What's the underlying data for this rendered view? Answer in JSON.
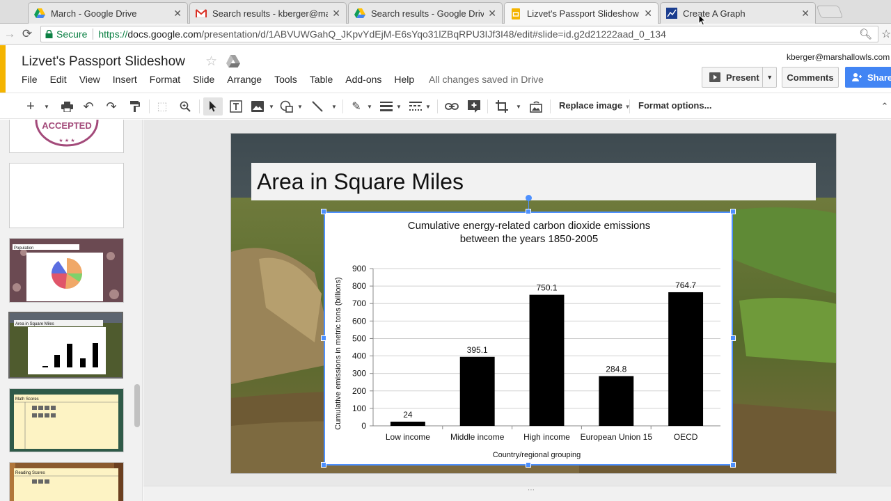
{
  "browser": {
    "tabs": [
      {
        "title": "March - Google Drive",
        "icon": "google-drive-icon"
      },
      {
        "title": "Search results - kberger@mars",
        "icon": "gmail-icon"
      },
      {
        "title": "Search results - Google Drive",
        "icon": "google-drive-icon"
      },
      {
        "title": "Lizvet's Passport Slideshow - G",
        "icon": "google-slides-icon",
        "active": true
      },
      {
        "title": "Create A Graph",
        "icon": "graph-icon"
      }
    ],
    "secure_label": "Secure",
    "url_scheme": "https://",
    "url_host": "docs.google.com",
    "url_path": "/presentation/d/1ABVUWGahQ_JKpvYdEjM-E6sYqo31lZBqRPU3IJf3I48/edit#slide=id.g2d21222aad_0_134"
  },
  "doc": {
    "title": "Lizvet's Passport Slideshow",
    "user_email": "kberger@marshallowls.com",
    "menu": [
      "File",
      "Edit",
      "View",
      "Insert",
      "Format",
      "Slide",
      "Arrange",
      "Tools",
      "Table",
      "Add-ons",
      "Help"
    ],
    "saved_status": "All changes saved in Drive",
    "present_label": "Present",
    "comments_label": "Comments",
    "share_label": "Share"
  },
  "toolbar": {
    "replace_image_label": "Replace image",
    "format_options_label": "Format options..."
  },
  "filmstrip": {
    "thumbs": [
      {
        "label": "ACCEPTED"
      },
      {
        "label": ""
      },
      {
        "label": "Population"
      },
      {
        "label": "Area in Square Miles"
      },
      {
        "label": "Math Scores"
      },
      {
        "label": "Reading Scores"
      }
    ]
  },
  "slide": {
    "title": "Area in Square Miles"
  },
  "colors": {
    "accent_yellow": "#f4b400",
    "share_blue": "#4285f4",
    "selection_blue": "#4d90fe",
    "bar": "#000000",
    "secure_green": "#0b8043"
  },
  "chart_data": {
    "type": "bar",
    "title": "Cumulative energy-related carbon dioxide emissions between the years 1850-2005",
    "title_lines": [
      "Cumulative energy-related carbon dioxide emissions",
      "between the years 1850-2005"
    ],
    "categories": [
      "Low income",
      "Middle income",
      "High income",
      "European Union 15",
      "OECD"
    ],
    "values": [
      24,
      395.1,
      750.1,
      284.8,
      764.7
    ],
    "value_labels": [
      "24",
      "395.1",
      "750.1",
      "284.8",
      "764.7"
    ],
    "xlabel": "Country/regional grouping",
    "ylabel": "Cumulative emissions in metric tons (billions)",
    "ylim": [
      0,
      900
    ],
    "yticks": [
      "0",
      "100",
      "200",
      "300",
      "400",
      "500",
      "600",
      "700",
      "800",
      "900"
    ],
    "grid": true,
    "legend": "none"
  }
}
